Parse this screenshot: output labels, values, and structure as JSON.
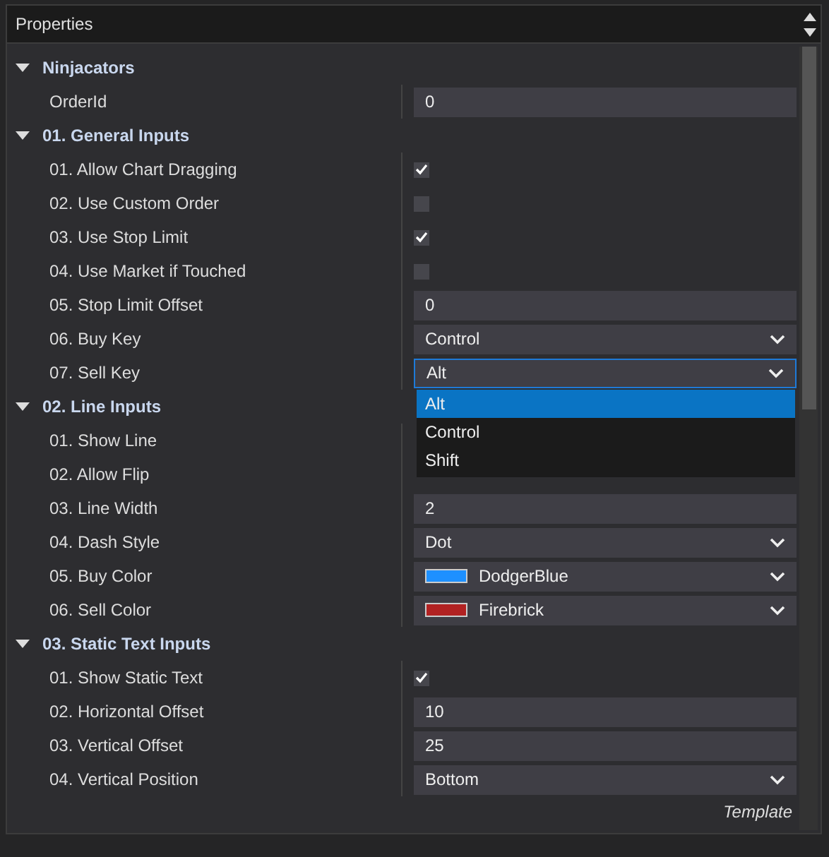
{
  "header": {
    "title": "Properties"
  },
  "categories": [
    {
      "title": "Ninjacators",
      "expanded": true,
      "properties": [
        {
          "name": "OrderId",
          "kind": "text",
          "value": "0"
        }
      ]
    },
    {
      "title": "01. General Inputs",
      "expanded": true,
      "properties": [
        {
          "name": "01. Allow Chart Dragging",
          "kind": "checkbox",
          "checked": true
        },
        {
          "name": "02. Use Custom Order",
          "kind": "checkbox",
          "checked": false
        },
        {
          "name": "03. Use Stop Limit",
          "kind": "checkbox",
          "checked": true
        },
        {
          "name": "04. Use Market if Touched",
          "kind": "checkbox",
          "checked": false
        },
        {
          "name": "05. Stop Limit Offset",
          "kind": "text",
          "value": "0"
        },
        {
          "name": "06. Buy Key",
          "kind": "select",
          "value": "Control",
          "open": false
        },
        {
          "name": "07. Sell Key",
          "kind": "select",
          "value": "Alt",
          "open": true,
          "options": [
            {
              "label": "Alt",
              "selected": true
            },
            {
              "label": "Control",
              "selected": false
            },
            {
              "label": "Shift",
              "selected": false
            }
          ]
        }
      ]
    },
    {
      "title": "02. Line Inputs",
      "expanded": true,
      "properties": [
        {
          "name": "01. Show Line",
          "kind": "covered"
        },
        {
          "name": "02. Allow Flip",
          "kind": "covered"
        },
        {
          "name": "03. Line Width",
          "kind": "text",
          "value": "2"
        },
        {
          "name": "04. Dash Style",
          "kind": "select",
          "value": "Dot",
          "open": false
        },
        {
          "name": "05. Buy Color",
          "kind": "color",
          "value": "DodgerBlue",
          "color": "#1e90ff"
        },
        {
          "name": "06. Sell Color",
          "kind": "color",
          "value": "Firebrick",
          "color": "#b22222"
        }
      ]
    },
    {
      "title": "03. Static Text Inputs",
      "expanded": true,
      "properties": [
        {
          "name": "01. Show Static Text",
          "kind": "checkbox",
          "checked": true
        },
        {
          "name": "02. Horizontal Offset",
          "kind": "text",
          "value": "10"
        },
        {
          "name": "03. Vertical Offset",
          "kind": "text",
          "value": "25"
        },
        {
          "name": "04. Vertical Position",
          "kind": "select",
          "value": "Bottom",
          "open": false
        }
      ]
    }
  ],
  "footer": {
    "link": "Template"
  }
}
